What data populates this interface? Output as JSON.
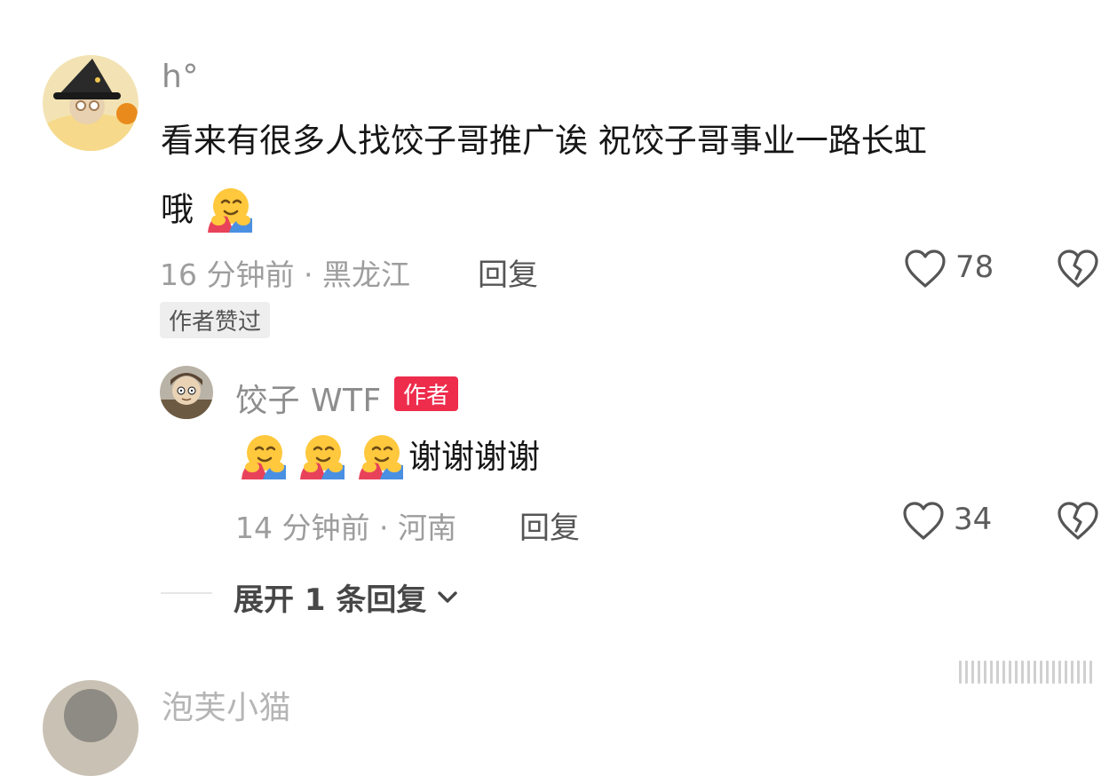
{
  "comments": [
    {
      "username": "h°",
      "text_line1": "看来有很多人找饺子哥推广诶 祝饺子哥事业一路长虹",
      "text_line2": "哦",
      "emoji": "hugging-face-emoji",
      "meta": "16 分钟前 · 黑龙江",
      "reply_label": "回复",
      "like_count": "78",
      "liked_badge": "作者赞过"
    }
  ],
  "replies": [
    {
      "username": "饺子 WTF",
      "author_badge": "作者",
      "text": "谢谢谢谢",
      "emoji": "hugging-face-emoji",
      "emoji_count": 3,
      "meta": "14 分钟前 · 河南",
      "reply_label": "回复",
      "like_count": "34"
    }
  ],
  "expand": {
    "label": "展开 1 条回复"
  },
  "next_comment": {
    "username_partial": "泡芙小猫"
  },
  "colors": {
    "author_badge": "#ee2c4c",
    "meta_text": "#9d9d9d",
    "username": "#8d8d8d",
    "body_text": "#161616"
  }
}
